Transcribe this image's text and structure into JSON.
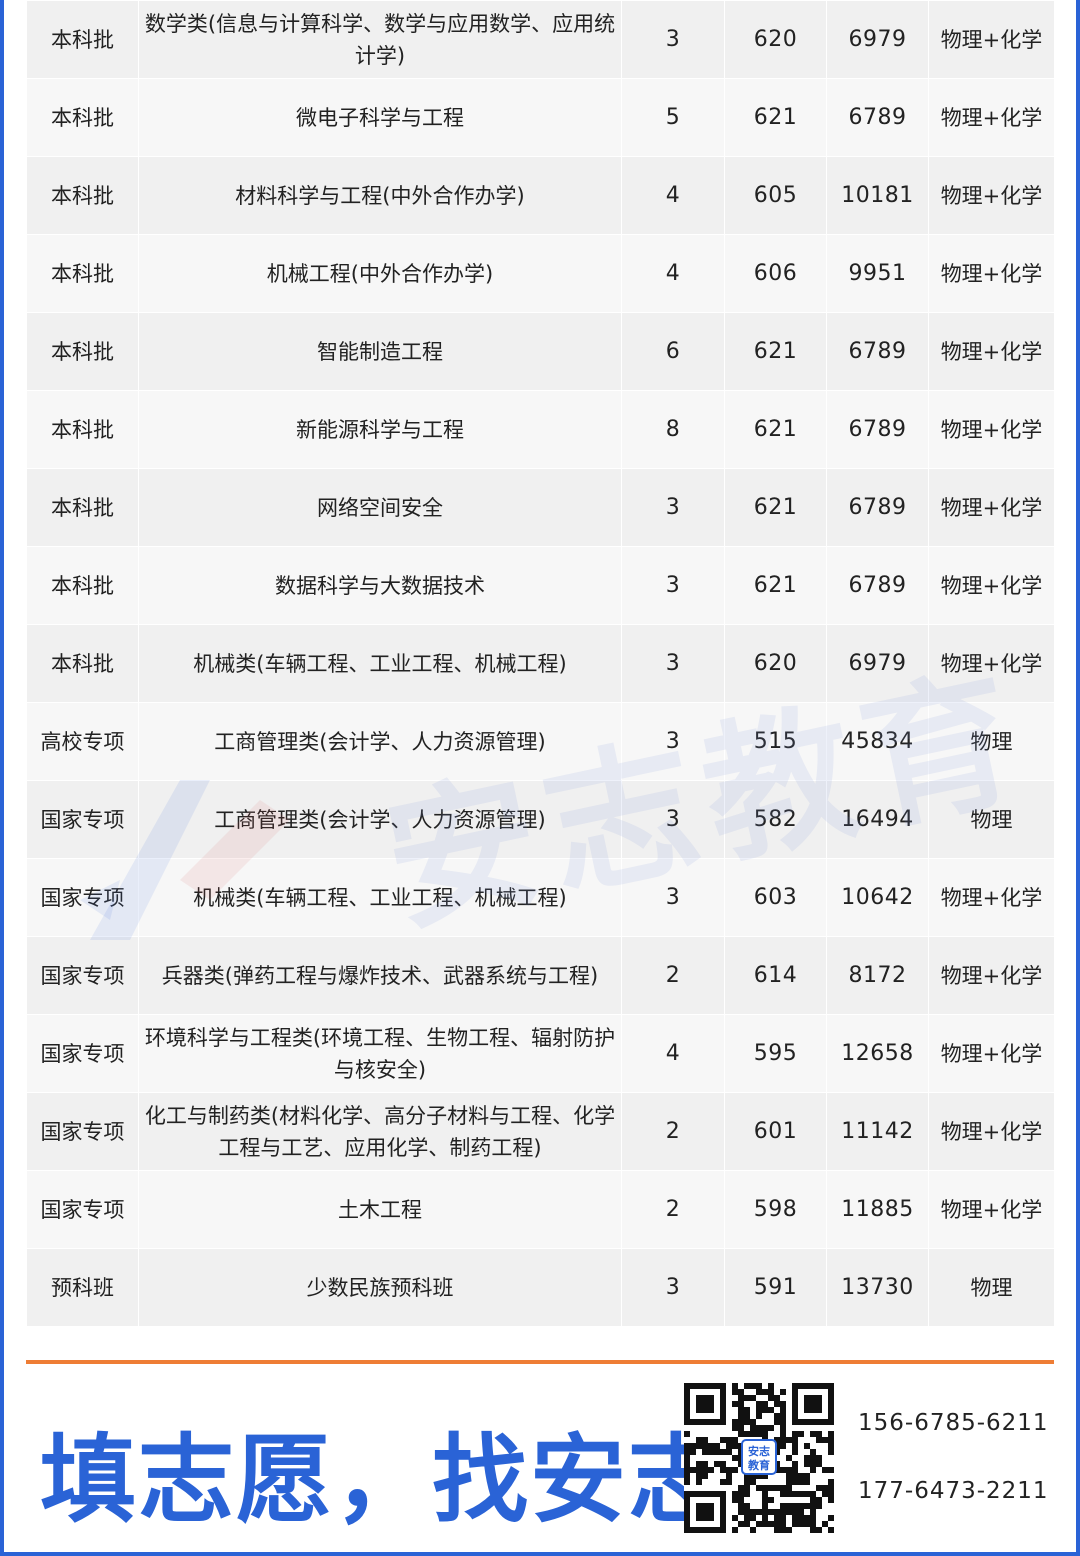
{
  "rows": [
    {
      "batch": "本科批",
      "major": "数学类(信息与计算科学、数学与应用数学、应用统计学)",
      "plan": "3",
      "score": "620",
      "rank": "6979",
      "subjects": "物理+化学"
    },
    {
      "batch": "本科批",
      "major": "微电子科学与工程",
      "plan": "5",
      "score": "621",
      "rank": "6789",
      "subjects": "物理+化学"
    },
    {
      "batch": "本科批",
      "major": "材料科学与工程(中外合作办学)",
      "plan": "4",
      "score": "605",
      "rank": "10181",
      "subjects": "物理+化学"
    },
    {
      "batch": "本科批",
      "major": "机械工程(中外合作办学)",
      "plan": "4",
      "score": "606",
      "rank": "9951",
      "subjects": "物理+化学"
    },
    {
      "batch": "本科批",
      "major": "智能制造工程",
      "plan": "6",
      "score": "621",
      "rank": "6789",
      "subjects": "物理+化学"
    },
    {
      "batch": "本科批",
      "major": "新能源科学与工程",
      "plan": "8",
      "score": "621",
      "rank": "6789",
      "subjects": "物理+化学"
    },
    {
      "batch": "本科批",
      "major": "网络空间安全",
      "plan": "3",
      "score": "621",
      "rank": "6789",
      "subjects": "物理+化学"
    },
    {
      "batch": "本科批",
      "major": "数据科学与大数据技术",
      "plan": "3",
      "score": "621",
      "rank": "6789",
      "subjects": "物理+化学"
    },
    {
      "batch": "本科批",
      "major": "机械类(车辆工程、工业工程、机械工程)",
      "plan": "3",
      "score": "620",
      "rank": "6979",
      "subjects": "物理+化学"
    },
    {
      "batch": "高校专项",
      "major": "工商管理类(会计学、人力资源管理)",
      "plan": "3",
      "score": "515",
      "rank": "45834",
      "subjects": "物理"
    },
    {
      "batch": "国家专项",
      "major": "工商管理类(会计学、人力资源管理)",
      "plan": "3",
      "score": "582",
      "rank": "16494",
      "subjects": "物理"
    },
    {
      "batch": "国家专项",
      "major": "机械类(车辆工程、工业工程、机械工程)",
      "plan": "3",
      "score": "603",
      "rank": "10642",
      "subjects": "物理+化学"
    },
    {
      "batch": "国家专项",
      "major": "兵器类(弹药工程与爆炸技术、武器系统与工程)",
      "plan": "2",
      "score": "614",
      "rank": "8172",
      "subjects": "物理+化学"
    },
    {
      "batch": "国家专项",
      "major": "环境科学与工程类(环境工程、生物工程、辐射防护与核安全)",
      "plan": "4",
      "score": "595",
      "rank": "12658",
      "subjects": "物理+化学"
    },
    {
      "batch": "国家专项",
      "major": "化工与制药类(材料化学、高分子材料与工程、化学工程与工艺、应用化学、制药工程)",
      "plan": "2",
      "score": "601",
      "rank": "11142",
      "subjects": "物理+化学"
    },
    {
      "batch": "国家专项",
      "major": "土木工程",
      "plan": "2",
      "score": "598",
      "rank": "11885",
      "subjects": "物理+化学"
    },
    {
      "batch": "预科班",
      "major": "少数民族预科班",
      "plan": "3",
      "score": "591",
      "rank": "13730",
      "subjects": "物理"
    }
  ],
  "footer": {
    "slogan": "填志愿，找安志",
    "qr_badge": "安志教育",
    "phones": [
      "156-6785-6211",
      "177-6473-2211"
    ]
  },
  "watermark": {
    "text": "安志教育"
  },
  "colors": {
    "brand_blue": "#2a63d6",
    "accent_orange": "#ee7d35",
    "row_odd": "#f0f0f0",
    "row_even": "#f7f7f7"
  }
}
